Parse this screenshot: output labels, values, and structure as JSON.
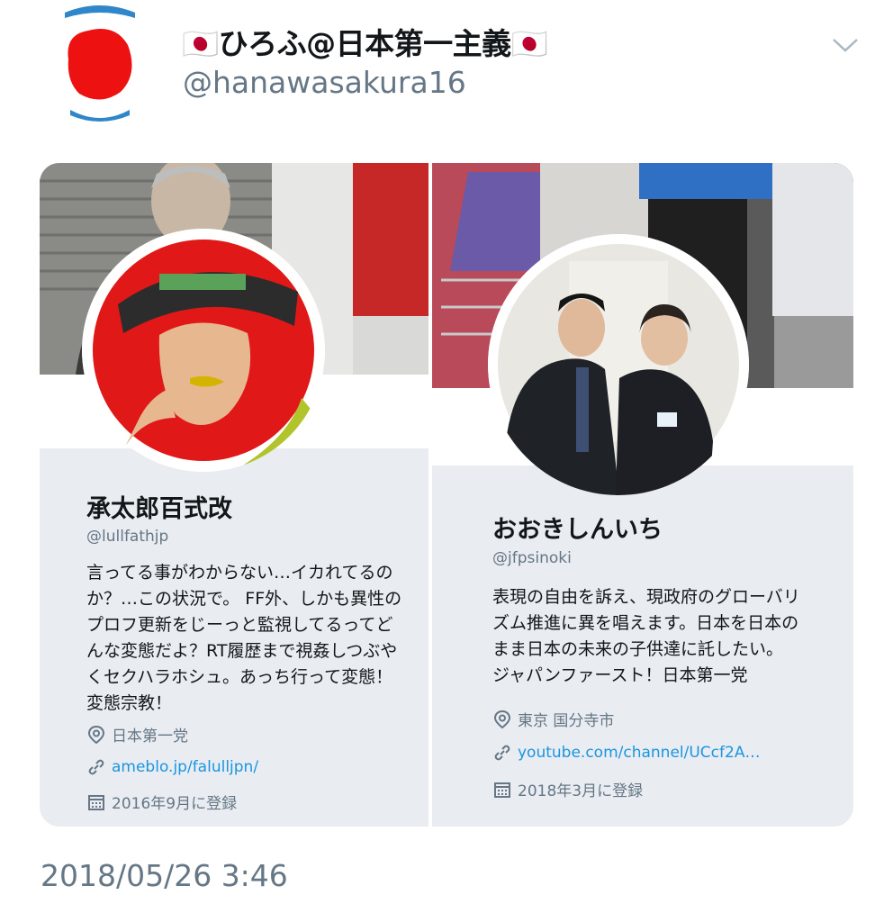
{
  "tweet": {
    "display_name": "🇯🇵ひろふ@日本第一主義🇯🇵",
    "handle": "@hanawasakura16",
    "timestamp": "2018/05/26 3:46"
  },
  "cards": [
    {
      "name": "承太郎百式改",
      "handle": "@lullfathjp",
      "bio_lines": [
        "言ってる事がわからない…イカれてるの",
        "か？…この状況で。 FF外、しかも異性の",
        "プロフ更新をじーっと監視してるってど",
        "んな変態だよ？RT履歴まで視姦しつぶや",
        "くセクハラホシュ。あっち行って変態！",
        "変態宗教！"
      ],
      "location": "日本第一党",
      "url": "ameblo.jp/falulljpn/",
      "joined": "2016年9月に登録"
    },
    {
      "name": "おおきしんいち",
      "handle": "@jfpsinoki",
      "bio_lines": [
        "表現の自由を訴え、現政府のグローバリ",
        "ズム推進に異を唱えます。日本を日本の",
        "まま日本の未来の子供達に託したい。",
        "ジャパンファースト！日本第一党"
      ],
      "location": "東京 国分寺市",
      "url": "youtube.com/channel/UCcf2A…",
      "joined": "2018年3月に登録"
    }
  ],
  "icons": {
    "location": "map-pin-icon",
    "link": "link-icon",
    "calendar": "calendar-icon",
    "menu": "chevron-down-icon"
  },
  "colors": {
    "link": "#1b95e0",
    "muted": "#657786",
    "card_bg": "#e9ecf0"
  }
}
